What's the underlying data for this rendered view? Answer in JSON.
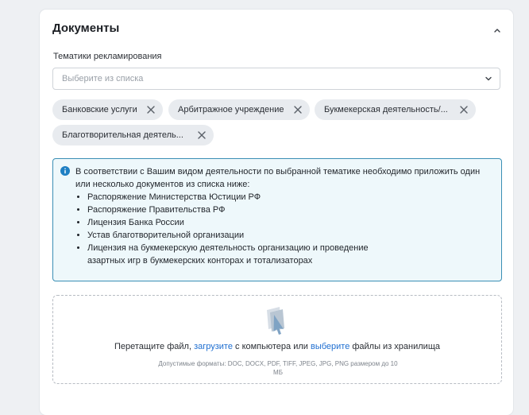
{
  "section": {
    "title": "Документы"
  },
  "themes": {
    "label": "Тематики рекламирования",
    "placeholder": "Выберите из списка",
    "chips": [
      "Банковские услуги",
      "Арбитражное учреждение",
      "Букмекерская деятельность/...",
      "Благотворительная деятель..."
    ]
  },
  "info": {
    "intro": "В соответствии с Вашим видом деятельности по выбранной тематике необходимо приложить один или несколько документов из списка ниже:",
    "items": [
      "Распоряжение Министерства Юстиции РФ",
      "Распоряжение Правительства РФ",
      "Лицензия Банка России",
      "Устав благотворительной организации",
      "Лицензия на букмекерскую деятельность организацию и проведение азартных игр в букмекерских конторах и тотализаторах"
    ]
  },
  "upload": {
    "text_start": "Перетащите файл, ",
    "link_upload": "загрузите",
    "text_middle": " с компьютера или ",
    "link_choose": "выберите",
    "text_end": " файлы из хранилища",
    "hint": "Допустимые форматы: DOC, DOCX, PDF, TIFF, JPEG, JPG, PNG размером до 10 МБ"
  },
  "icons": {
    "collapse": "chevron-up-icon",
    "select": "chevron-down-icon",
    "chip_remove": "close-icon",
    "info": "info-icon",
    "upload": "file-upload-icon"
  },
  "colors": {
    "info_border": "#3a8fb5",
    "info_bg": "#eef8fb",
    "link": "#1f6fd1",
    "info_icon": "#1e7fc3"
  }
}
